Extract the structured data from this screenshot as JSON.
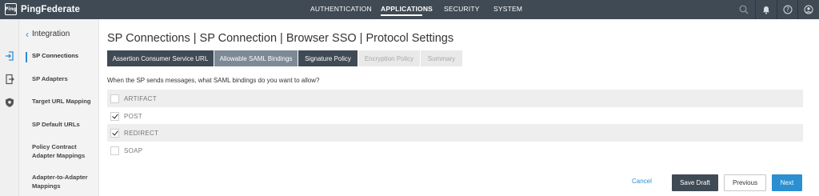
{
  "brand": {
    "logo_mark": "Ping",
    "name": "PingFederate"
  },
  "nav": {
    "items": [
      {
        "label": "AUTHENTICATION"
      },
      {
        "label": "APPLICATIONS",
        "active": true
      },
      {
        "label": "SECURITY"
      },
      {
        "label": "SYSTEM"
      }
    ]
  },
  "top_icons": [
    "search-icon",
    "bell-icon",
    "help-icon",
    "user-icon"
  ],
  "rail_icons": [
    "sign-in-icon",
    "sign-out-icon",
    "shield-icon"
  ],
  "sidebar": {
    "back_label": "Integration",
    "items": [
      {
        "label": "SP Connections",
        "selected": true
      },
      {
        "label": "SP Adapters"
      },
      {
        "label": "Target URL Mapping"
      },
      {
        "label": "SP Default URLs"
      },
      {
        "label": "Policy Contract Adapter Mappings"
      },
      {
        "label": "Adapter-to-Adapter Mappings"
      }
    ]
  },
  "page": {
    "title": "SP Connections | SP Connection | Browser SSO | Protocol Settings",
    "tabs": [
      {
        "label": "Assertion Consumer Service URL",
        "state": "done"
      },
      {
        "label": "Allowable SAML Bindings",
        "state": "current"
      },
      {
        "label": "Signature Policy",
        "state": "done"
      },
      {
        "label": "Encryption Policy",
        "state": "disabled"
      },
      {
        "label": "Summary",
        "state": "disabled"
      }
    ],
    "question": "When the SP sends messages, what SAML bindings do you want to allow?",
    "bindings": [
      {
        "label": "ARTIFACT",
        "checked": false
      },
      {
        "label": "POST",
        "checked": true
      },
      {
        "label": "REDIRECT",
        "checked": true
      },
      {
        "label": "SOAP",
        "checked": false
      }
    ]
  },
  "footer": {
    "cancel": "Cancel",
    "save_draft": "Save Draft",
    "previous": "Previous",
    "next": "Next"
  },
  "colors": {
    "topbar": "#3f4a54",
    "accent": "#2b8fd1",
    "tab_current": "#7d8a96",
    "tab_disabled": "#e9e9e9"
  }
}
